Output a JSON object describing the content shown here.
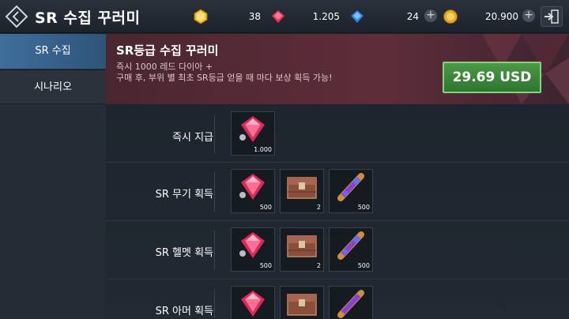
{
  "header": {
    "title": "SR 수집 꾸러미",
    "currencies": [
      {
        "icon": "gold-gem-icon",
        "value": "38"
      },
      {
        "icon": "red-diamond-icon",
        "value": "1.205"
      },
      {
        "icon": "blue-diamond-icon",
        "value": "24"
      },
      {
        "icon": "gold-coin-icon",
        "value": "20.900"
      }
    ],
    "plus": "+"
  },
  "sidebar": {
    "items": [
      {
        "label": "SR 수집"
      },
      {
        "label": "시나리오"
      }
    ]
  },
  "banner": {
    "title": "SR등급 수집 꾸러미",
    "line1": "즉시 1000 레드 다이아 +",
    "line2": "구매 후, 부위 별 최초 SR등급 얻을 때 마다 보상 획득 가능!",
    "price": "29.69 USD"
  },
  "rows": [
    {
      "label": "즉시 지급",
      "items": [
        {
          "icon": "red-diamond-icon",
          "qty": "1.000"
        }
      ]
    },
    {
      "label": "SR 무기 획득",
      "items": [
        {
          "icon": "red-diamond-icon",
          "qty": "500"
        },
        {
          "icon": "treasure-chest-icon",
          "qty": "2"
        },
        {
          "icon": "scroll-icon",
          "qty": "500"
        }
      ]
    },
    {
      "label": "SR 헬멧 획득",
      "items": [
        {
          "icon": "red-diamond-icon",
          "qty": "500"
        },
        {
          "icon": "treasure-chest-icon",
          "qty": "2"
        },
        {
          "icon": "scroll-icon",
          "qty": "500"
        }
      ]
    },
    {
      "label": "SR 아머 획득",
      "items": [
        {
          "icon": "red-diamond-icon",
          "qty": ""
        },
        {
          "icon": "treasure-chest-icon",
          "qty": ""
        },
        {
          "icon": "scroll-icon",
          "qty": ""
        }
      ]
    }
  ]
}
